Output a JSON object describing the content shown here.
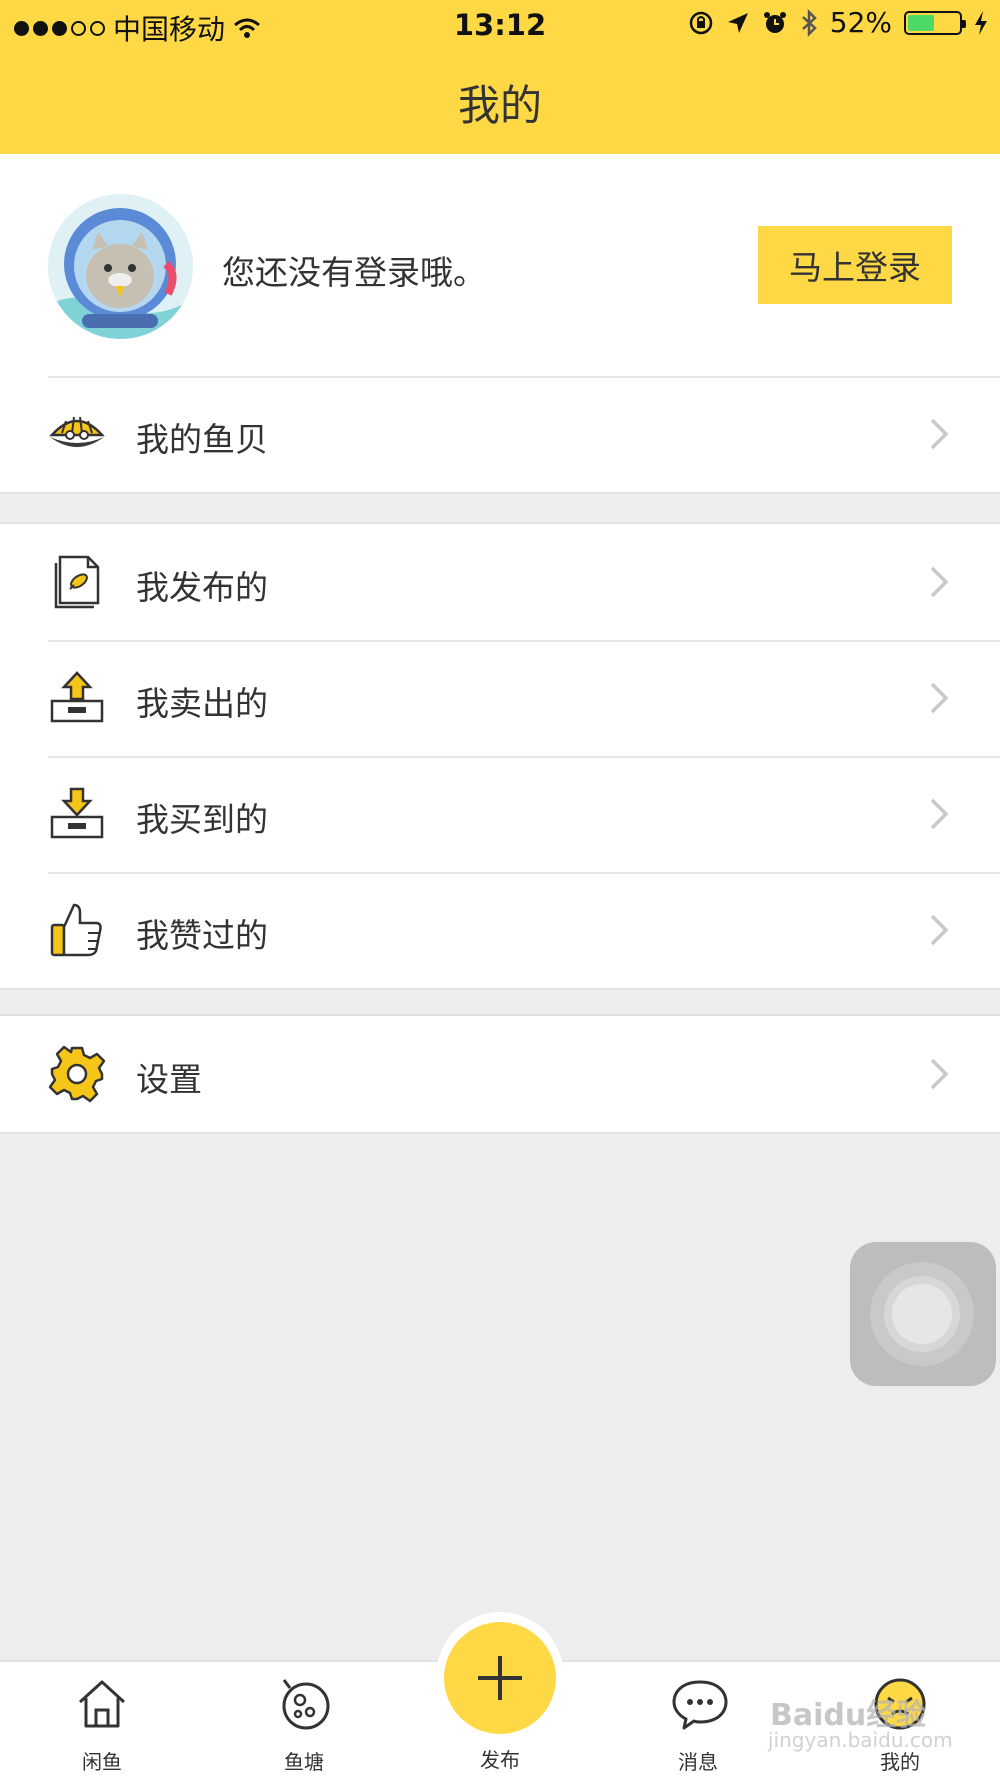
{
  "status_bar": {
    "carrier": "中国移动",
    "time": "13:12",
    "battery_percent": "52%",
    "battery_level": 0.52,
    "battery_color": "#4cd964"
  },
  "header": {
    "title": "我的",
    "background": "#ffd945"
  },
  "profile": {
    "login_prompt": "您还没有登录哦。",
    "login_button": "马上登录"
  },
  "menu": {
    "fish_shell": "我的鱼贝",
    "published": "我发布的",
    "sold": "我卖出的",
    "bought": "我买到的",
    "liked": "我赞过的",
    "settings": "设置"
  },
  "icons": {
    "fish_shell": "clam-shell-icon",
    "published": "document-icon",
    "sold": "upload-tray-icon",
    "bought": "download-tray-icon",
    "liked": "thumbs-up-icon",
    "settings": "gear-icon"
  },
  "tabbar": {
    "home": "闲鱼",
    "pond": "鱼塘",
    "publish": "发布",
    "messages": "消息",
    "mine": "我的"
  },
  "watermark": {
    "main": "Baidu经验",
    "sub": "jingyan.baidu.com"
  }
}
